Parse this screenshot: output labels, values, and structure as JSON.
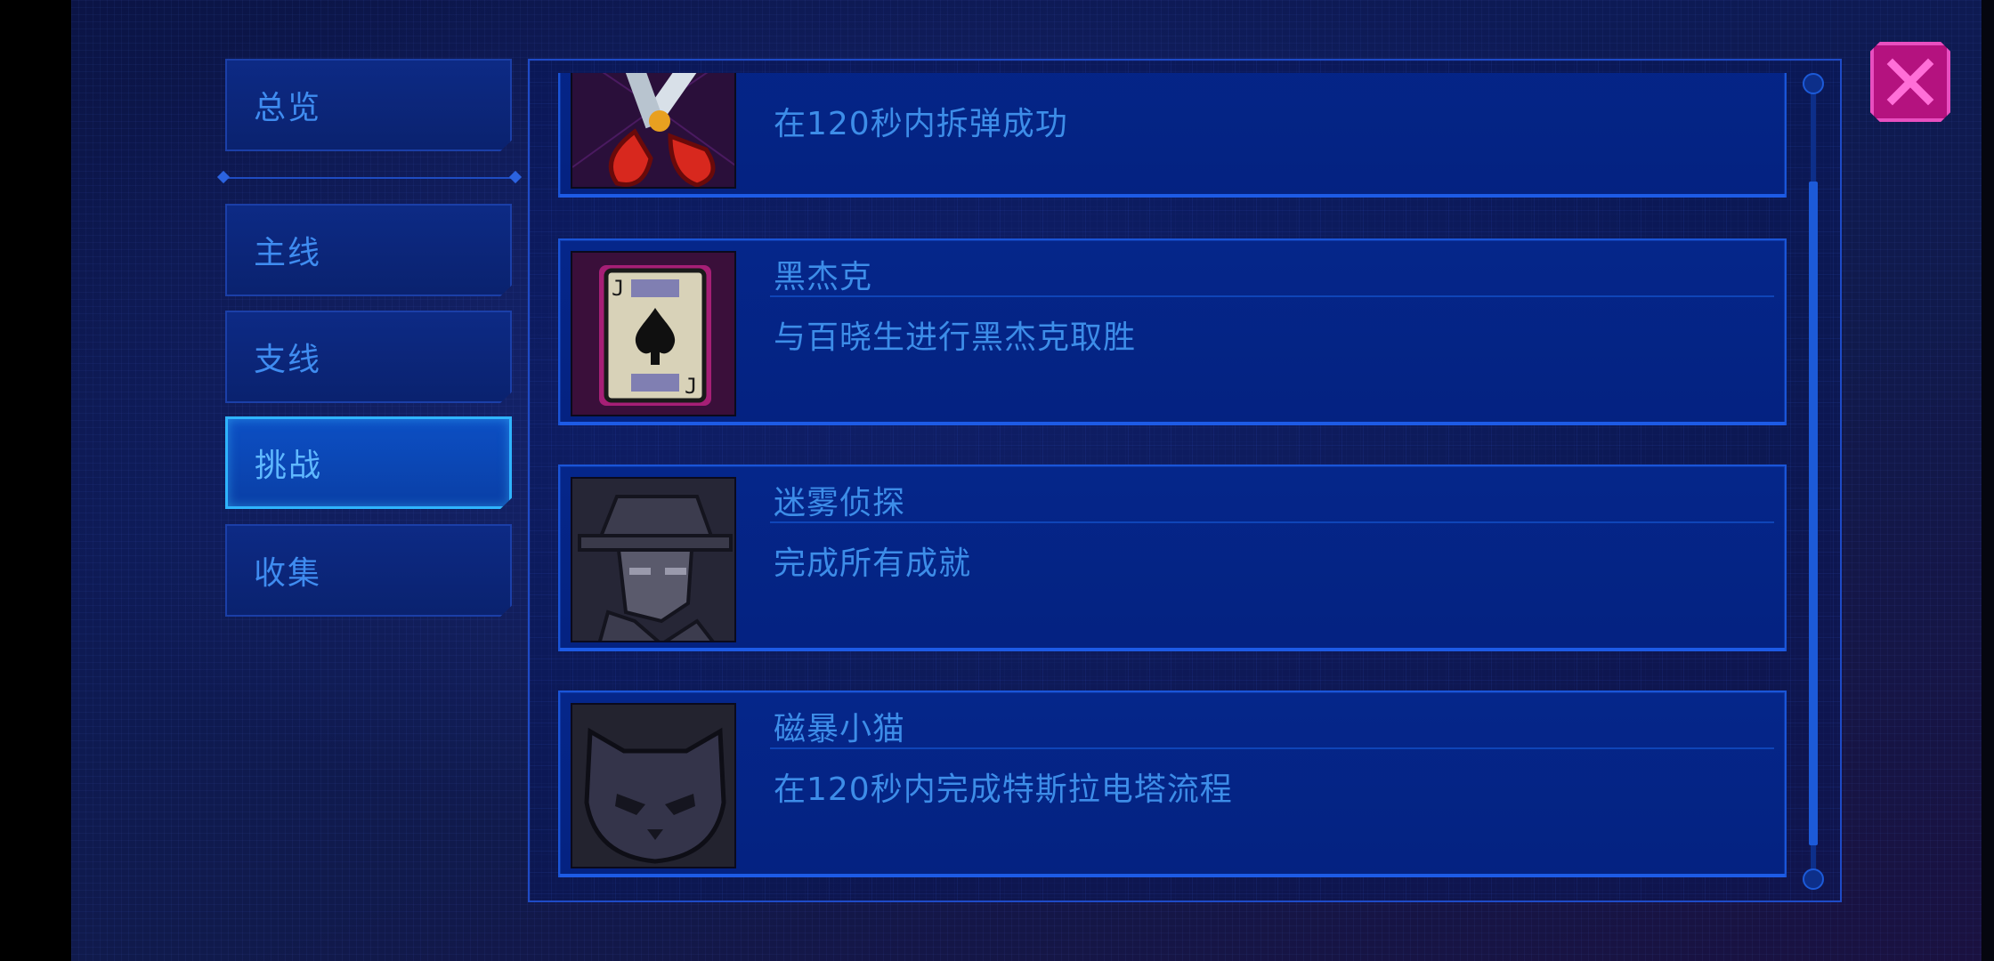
{
  "sidebar": {
    "tabs": [
      {
        "label": "总览",
        "active": false
      },
      {
        "label": "主线",
        "active": false
      },
      {
        "label": "支线",
        "active": false
      },
      {
        "label": "挑战",
        "active": true
      },
      {
        "label": "收集",
        "active": false
      }
    ]
  },
  "achievements": [
    {
      "title": "",
      "description": "在120秒内拆弹成功",
      "icon": "pliers-icon"
    },
    {
      "title": "黑杰克",
      "description": "与百晓生进行黑杰克取胜",
      "icon": "playing-card-jack-icon"
    },
    {
      "title": "迷雾侦探",
      "description": "完成所有成就",
      "icon": "detective-icon"
    },
    {
      "title": "磁暴小猫",
      "description": "在120秒内完成特斯拉电塔流程",
      "icon": "cat-icon"
    }
  ],
  "colors": {
    "accent_text": "#3d8de8",
    "active_tab_border": "#2fb4ff",
    "close_button": "#b4127f"
  }
}
